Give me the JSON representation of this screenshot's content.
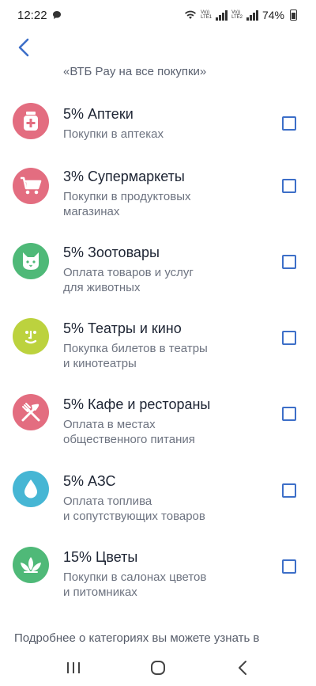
{
  "status_bar": {
    "time": "12:22",
    "sim1": "LTE1",
    "sim2": "LTE2",
    "volte": "Vo))",
    "battery": "74%"
  },
  "header": {
    "truncated_text": "«ВТБ Pay на все покупки»"
  },
  "categories": [
    {
      "title": "5% Аптеки",
      "subtitle_lines": [
        "Покупки в аптеках"
      ],
      "color": "#e36d80",
      "icon": "pharmacy-icon"
    },
    {
      "title": "3% Супермаркеты",
      "subtitle_lines": [
        "Покупки в продуктовых",
        "магазинах"
      ],
      "color": "#e36d80",
      "icon": "cart-icon"
    },
    {
      "title": "5% Зоотовары",
      "subtitle_lines": [
        "Оплата товаров и услуг",
        "для животных"
      ],
      "color": "#4fb978",
      "icon": "cat-icon"
    },
    {
      "title": "5% Театры и кино",
      "subtitle_lines": [
        "Покупка билетов в театры",
        "и кинотеатры"
      ],
      "color": "#bcd23e",
      "icon": "smile-icon"
    },
    {
      "title": "5% Кафе и рестораны",
      "subtitle_lines": [
        "Оплата в местах",
        "общественного питания"
      ],
      "color": "#e36d80",
      "icon": "cutlery-icon"
    },
    {
      "title": "5% АЗС",
      "subtitle_lines": [
        "Оплата топлива",
        "и сопутствующих товаров"
      ],
      "color": "#46b6d4",
      "icon": "drop-icon"
    },
    {
      "title": "15% Цветы",
      "subtitle_lines": [
        "Покупки в салонах цветов",
        "и питомниках"
      ],
      "color": "#4fb978",
      "icon": "flower-icon"
    }
  ],
  "footer": {
    "text": "Подробнее о категориях вы можете узнать в"
  }
}
